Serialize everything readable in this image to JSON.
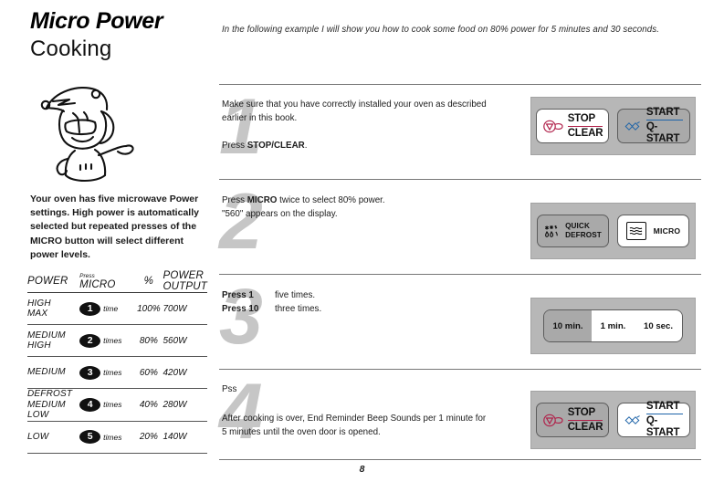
{
  "page": {
    "title_main": "Micro Power",
    "title_sub": "Cooking",
    "page_number": "8",
    "lead_text": "In the following example I will show you how to cook some food on 80% power for 5 minutes and 30 seconds.",
    "intro_paragraph": "Your oven has five microwave Power settings. High power is automatically selected but repeated presses of the MICRO button will select different power levels."
  },
  "power_table": {
    "headers": {
      "power": "POWER",
      "micro_small": "Press",
      "micro": "MICRO",
      "percent": "%",
      "output_line1": "POWER",
      "output_line2": "OUTPUT"
    },
    "rows": [
      {
        "name_line1": "HIGH",
        "name_line2": "MAX",
        "presses": "1",
        "times": "time",
        "percent": "100%",
        "output": "700W"
      },
      {
        "name_line1": "MEDIUM",
        "name_line2": "HIGH",
        "presses": "2",
        "times": "times",
        "percent": "80%",
        "output": "560W"
      },
      {
        "name_line1": "MEDIUM",
        "name_line2": "",
        "presses": "3",
        "times": "times",
        "percent": "60%",
        "output": "420W"
      },
      {
        "name_line1": "DEFROST",
        "name_line2": "MEDIUM LOW",
        "presses": "4",
        "times": "times",
        "percent": "40%",
        "output": "280W"
      },
      {
        "name_line1": "LOW",
        "name_line2": "",
        "presses": "5",
        "times": "times",
        "percent": "20%",
        "output": "140W"
      }
    ]
  },
  "steps": [
    {
      "number": "1",
      "line1": "Make sure that you have correctly installed your oven as described",
      "line2": "earlier in this book.",
      "action_prefix": "Press ",
      "action_bold": "STOP/CLEAR",
      "action_suffix": ".",
      "panel": {
        "type": "stop-start",
        "stop_top": "STOP",
        "stop_bottom": "CLEAR",
        "start_top": "START",
        "start_bottom": "Q-START",
        "stop_state": "lit",
        "start_state": "dim"
      }
    },
    {
      "number": "2",
      "line1_prefix": "Press ",
      "line1_bold": "MICRO",
      "line1_suffix": " twice to select 80% power.",
      "line2": "\"560\" appears on the display.",
      "panel": {
        "type": "defrost-micro",
        "defrost_top": "QUICK",
        "defrost_bottom": "DEFROST",
        "micro_label": "MICRO",
        "defrost_state": "dim",
        "micro_state": "lit"
      }
    },
    {
      "number": "3",
      "rows": [
        {
          "c1": "Press 1",
          "c2": "five times."
        },
        {
          "c1": "Press 10",
          "c2": "three times."
        }
      ],
      "panel": {
        "type": "time-keys",
        "segments": [
          {
            "label": "10 min.",
            "state": "off"
          },
          {
            "label": "1 min.",
            "state": "on"
          },
          {
            "label": "10 sec.",
            "state": "on"
          }
        ]
      }
    },
    {
      "number": "4",
      "action_prefix": "P",
      "action_bold": "",
      "action_suffix": "ss",
      "line1": "After cooking is over, End Reminder Beep Sounds per 1 minute for",
      "line2": "5 minutes until the oven door is opened.",
      "panel": {
        "type": "stop-start",
        "stop_top": "STOP",
        "stop_bottom": "CLEAR",
        "start_top": "START",
        "start_bottom": "Q-START",
        "stop_state": "dim",
        "start_state": "lit"
      }
    }
  ],
  "colors": {
    "panel_bg": "#b7b7b7",
    "key_lit": "#ffffff",
    "key_dim": "#a9a9a9",
    "stop_accent": "#b0214a",
    "start_accent": "#1d63a8",
    "watermark": "#c6c6c6"
  }
}
